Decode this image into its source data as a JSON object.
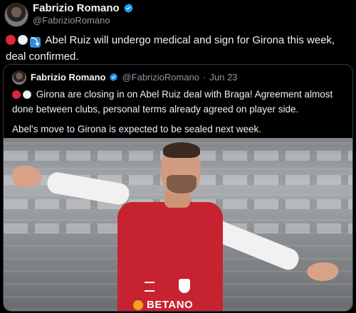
{
  "tweet": {
    "author_name": "Fabrizio Romano",
    "author_handle": "@FabrizioRomano",
    "text": "Abel Ruiz will undergo medical and sign for Girona this week, deal confirmed."
  },
  "quote": {
    "author_name": "Fabrizio Romano",
    "author_handle": "@FabrizioRomano",
    "date": "Jun 23",
    "paragraph1": "Girona are closing in on Abel Ruiz deal with Braga! Agreement almost done between clubs, personal terms already agreed on player side.",
    "paragraph2": "Abel's move to Girona is expected to be sealed next week."
  },
  "media": {
    "sponsor_text": "BETANO"
  },
  "colors": {
    "verified": "#1d9bf0",
    "red_dot": "#e0263c",
    "arrow_box": "#2f8cd8",
    "shirt_red": "#c7222f"
  },
  "icons": [
    "red-circle-icon",
    "white-circle-icon",
    "arrow-right-icon",
    "verified-badge-icon"
  ]
}
